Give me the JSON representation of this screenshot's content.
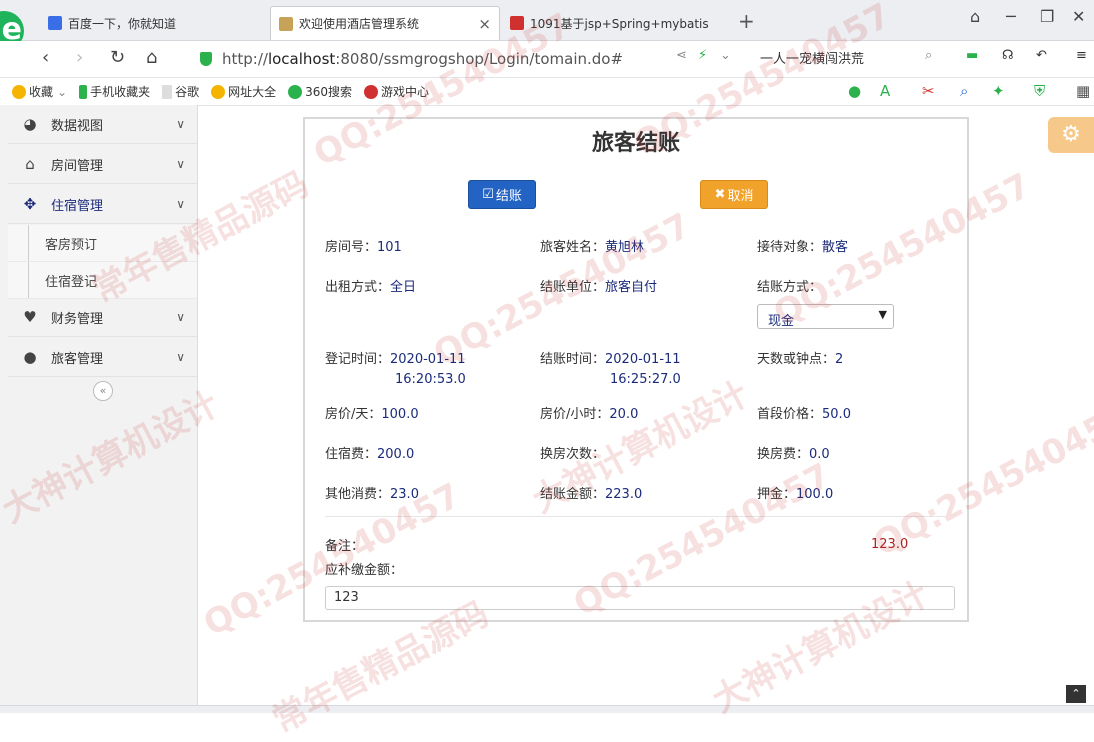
{
  "browser": {
    "tabs": [
      {
        "label": "百度一下，你就知道"
      },
      {
        "label": "欢迎使用酒店管理系统"
      },
      {
        "label": "1091基于jsp+Spring+mybatis"
      }
    ],
    "new_tab": "+",
    "url_prefix": "http://",
    "url_host": "localhost",
    "url_rest": ":8080/ssmgrogshop/Login/tomain.do#",
    "search_hint": "一人一宠横闯洪荒",
    "bookmarks": [
      {
        "label": "收藏",
        "icon": "star-icon",
        "color": "#f5b400"
      },
      {
        "label": "手机收藏夹",
        "icon": "phone-icon",
        "color": "#2bb24c"
      },
      {
        "label": "谷歌",
        "icon": "page-icon",
        "color": "#888888"
      },
      {
        "label": "网址大全",
        "icon": "globe-icon",
        "color": "#f5b400"
      },
      {
        "label": "360搜索",
        "icon": "search-icon",
        "color": "#2bb24c"
      },
      {
        "label": "游戏中心",
        "icon": "game-icon",
        "color": "#d0302f"
      }
    ]
  },
  "sidebar": {
    "items": [
      {
        "label": "数据视图",
        "icon": "dashboard-icon"
      },
      {
        "label": "房间管理",
        "icon": "home-icon"
      },
      {
        "label": "住宿管理",
        "icon": "move-icon"
      },
      {
        "label": "财务管理",
        "icon": "heart-icon"
      },
      {
        "label": "旅客管理",
        "icon": "user-icon"
      }
    ],
    "sub_items": [
      {
        "label": "客房预订"
      },
      {
        "label": "住宿登记"
      }
    ],
    "collapse_label": "«"
  },
  "form": {
    "title": "旅客结账",
    "checkout_label": "结账",
    "cancel_label": "取消",
    "fields": {
      "room_no": {
        "label": "房间号：",
        "value": "101"
      },
      "guest_name": {
        "label": "旅客姓名：",
        "value": "黄旭林"
      },
      "reception_target": {
        "label": "接待对象：",
        "value": "散客"
      },
      "rent_mode": {
        "label": "出租方式：",
        "value": "全日"
      },
      "bill_unit": {
        "label": "结账单位：",
        "value": "旅客自付"
      },
      "pay_method": {
        "label": "结账方式：",
        "value": "现金"
      },
      "checkin_time": {
        "label": "登记时间：",
        "value_date": "2020-01-11",
        "value_time": "16:20:53.0"
      },
      "checkout_time": {
        "label": "结账时间：",
        "value_date": "2020-01-11",
        "value_time": "16:25:27.0"
      },
      "days_or_hours": {
        "label": "天数或钟点：",
        "value": "2"
      },
      "price_per_day": {
        "label": "房价/天：",
        "value": "100.0"
      },
      "price_per_hour": {
        "label": "房价/小时：",
        "value": "20.0"
      },
      "first_period_price": {
        "label": "首段价格：",
        "value": "50.0"
      },
      "lodging_fee": {
        "label": "住宿费：",
        "value": "200.0"
      },
      "room_change_count": {
        "label": "换房次数：",
        "value": ""
      },
      "room_change_fee": {
        "label": "换房费：",
        "value": "0.0"
      },
      "other_fee": {
        "label": "其他消费：",
        "value": "23.0"
      },
      "total_amount": {
        "label": "结账金额：",
        "value": "223.0"
      },
      "deposit": {
        "label": "押金：",
        "value": "100.0"
      }
    },
    "remark_label": "备注：",
    "remark_amount": "123.0",
    "pay_due_label": "应补缴金额：",
    "pay_due_value": "123"
  },
  "watermarks": [
    "QQ:254540457",
    "常年售精品源码",
    "大神计算机设计"
  ],
  "colors": {
    "checkout": "#2263c4",
    "cancel": "#f0a22a",
    "value_text": "#1b2b7a",
    "remark_amount": "#b02020"
  }
}
